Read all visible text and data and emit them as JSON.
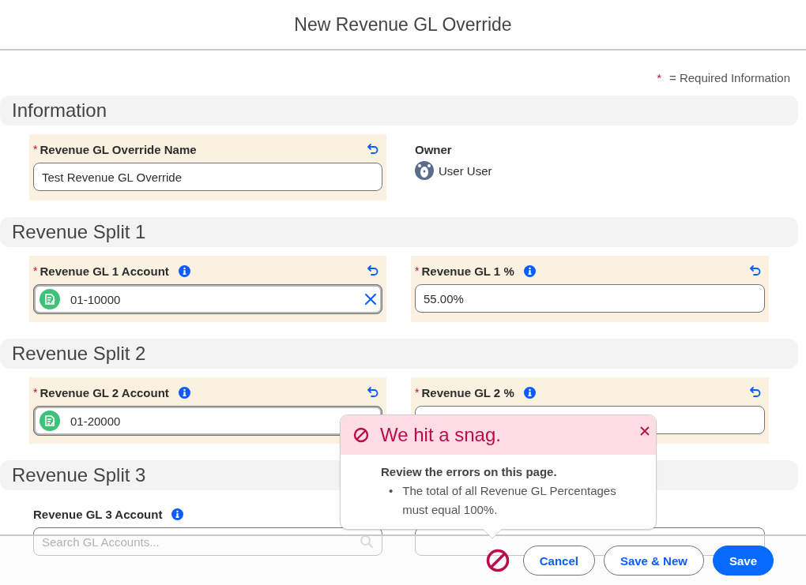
{
  "title": "New Revenue GL Override",
  "required_note": {
    "marker": "*",
    "text": "= Required Information"
  },
  "sections": [
    {
      "title": "Information",
      "fields": [
        {
          "kind": "text",
          "marker": "*",
          "label": "Revenue GL Override Name",
          "info": false,
          "edited": true,
          "value": "Test Revenue GL Override"
        },
        {
          "kind": "owner",
          "label": "Owner",
          "value": "User User"
        }
      ]
    },
    {
      "title": "Revenue Split 1",
      "fields": [
        {
          "kind": "lookup",
          "marker": "*",
          "label": "Revenue GL 1 Account",
          "info": true,
          "edited": true,
          "value": "01-10000",
          "clearable": true
        },
        {
          "kind": "text",
          "marker": "*",
          "label": "Revenue GL 1 %",
          "info": true,
          "edited": true,
          "value": "55.00%"
        }
      ]
    },
    {
      "title": "Revenue Split 2",
      "fields": [
        {
          "kind": "lookup",
          "marker": "*",
          "label": "Revenue GL 2 Account",
          "info": true,
          "edited": true,
          "value": "01-20000"
        },
        {
          "kind": "text",
          "marker": "*",
          "label": "Revenue GL 2 %",
          "info": true,
          "edited": true
        }
      ]
    },
    {
      "title": "Revenue Split 3",
      "fields": [
        {
          "kind": "search",
          "label": "Revenue GL 3 Account",
          "info": true,
          "edited": false,
          "placeholder": "Search GL Accounts..."
        },
        {
          "kind": "text",
          "edited": false
        }
      ]
    }
  ],
  "error_popover": {
    "title": "We hit a snag.",
    "heading": "Review the errors on this page.",
    "errors": [
      {
        "bullet": "•",
        "text": "The total of all Revenue GL Percentages must equal 100%."
      }
    ]
  },
  "footer": {
    "error_icon": true,
    "buttons": [
      {
        "label": "Cancel",
        "kind": "neutral"
      },
      {
        "label": "Save & New",
        "kind": "neutral"
      },
      {
        "label": "Save",
        "kind": "brand"
      }
    ]
  }
}
